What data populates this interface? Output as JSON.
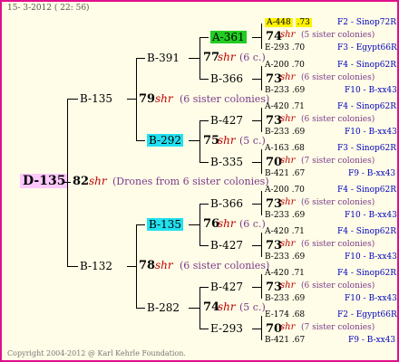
{
  "header": "15-  3-2012 ( 22: 56)",
  "footer": "Copyright 2004-2012 @ Karl Kehrle Foundation.",
  "colors": {
    "border": "#e0108c",
    "background": "#fffde7",
    "shr": "#c00000",
    "sister": "#7a3a8c",
    "blue": "#0000c0",
    "green_highlight": "#22cc22",
    "cyan_highlight": "#22e0f0",
    "yellow_highlight": "#fff200",
    "root_highlight": "#ffc8ff"
  },
  "root": {
    "label": "D-135",
    "number": "82",
    "shr": "shr",
    "note": "(Drones from 6 sister colonies)"
  },
  "gen1": [
    {
      "label": "B-135",
      "number": "79",
      "shr": "shr",
      "note": "(6 sister colonies)"
    },
    {
      "label": "B-132",
      "number": "78",
      "shr": "shr",
      "note": "(6 sister colonies)"
    }
  ],
  "gen2": [
    {
      "label": "B-391",
      "number": "77",
      "shr": "shr",
      "note": "(6 c.)"
    },
    {
      "label": "B-292",
      "number": "75",
      "shr": "shr",
      "note": "(5 c.)"
    },
    {
      "label": "B-135",
      "number": "76",
      "shr": "shr",
      "note": "(6 c.)"
    },
    {
      "label": "B-282",
      "number": "74",
      "shr": "shr",
      "note": "(5 c.)"
    }
  ],
  "gen3": [
    "A-361",
    "B-366",
    "B-427",
    "B-335",
    "B-366",
    "B-427",
    "B-427",
    "E-293"
  ],
  "gen4": [
    {
      "a_label": "A-448",
      "a_val": ".73",
      "a_right": "F2 - Sinop72R",
      "number": "74",
      "shr": "shr",
      "note": "(5 sister colonies)",
      "b_label": "E-293",
      "b_val": ".70",
      "b_right": "F3 - Egypt66R"
    },
    {
      "a_label": "A-200",
      "a_val": ".70",
      "a_right": "F4 - Sinop62R",
      "number": "73",
      "shr": "shr",
      "note": "(6 sister colonies)",
      "b_label": "B-233",
      "b_val": ".69",
      "b_right": "F10 - B-xx43"
    },
    {
      "a_label": "A-420",
      "a_val": ".71",
      "a_right": "F4 - Sinop62R",
      "number": "73",
      "shr": "shr",
      "note": "(6 sister colonies)",
      "b_label": "B-233",
      "b_val": ".69",
      "b_right": "F10 - B-xx43"
    },
    {
      "a_label": "A-163",
      "a_val": ".68",
      "a_right": "F3 - Sinop62R",
      "number": "70",
      "shr": "shr",
      "note": "(7 sister colonies)",
      "b_label": "B-421",
      "b_val": ".67",
      "b_right": "F9 - B-xx43"
    },
    {
      "a_label": "A-200",
      "a_val": ".70",
      "a_right": "F4 - Sinop62R",
      "number": "73",
      "shr": "shr",
      "note": "(6 sister colonies)",
      "b_label": "B-233",
      "b_val": ".69",
      "b_right": "F10 - B-xx43"
    },
    {
      "a_label": "A-420",
      "a_val": ".71",
      "a_right": "F4 - Sinop62R",
      "number": "73",
      "shr": "shr",
      "note": "(6 sister colonies)",
      "b_label": "B-233",
      "b_val": ".69",
      "b_right": "F10 - B-xx43"
    },
    {
      "a_label": "A-420",
      "a_val": ".71",
      "a_right": "F4 - Sinop62R",
      "number": "73",
      "shr": "shr",
      "note": "(6 sister colonies)",
      "b_label": "B-233",
      "b_val": ".69",
      "b_right": "F10 - B-xx43"
    },
    {
      "a_label": "E-174",
      "a_val": ".68",
      "a_right": "F2 - Egypt66R",
      "number": "70",
      "shr": "shr",
      "note": "(7 sister colonies)",
      "b_label": "B-421",
      "b_val": ".67",
      "b_right": "F9 - B-xx43"
    }
  ]
}
